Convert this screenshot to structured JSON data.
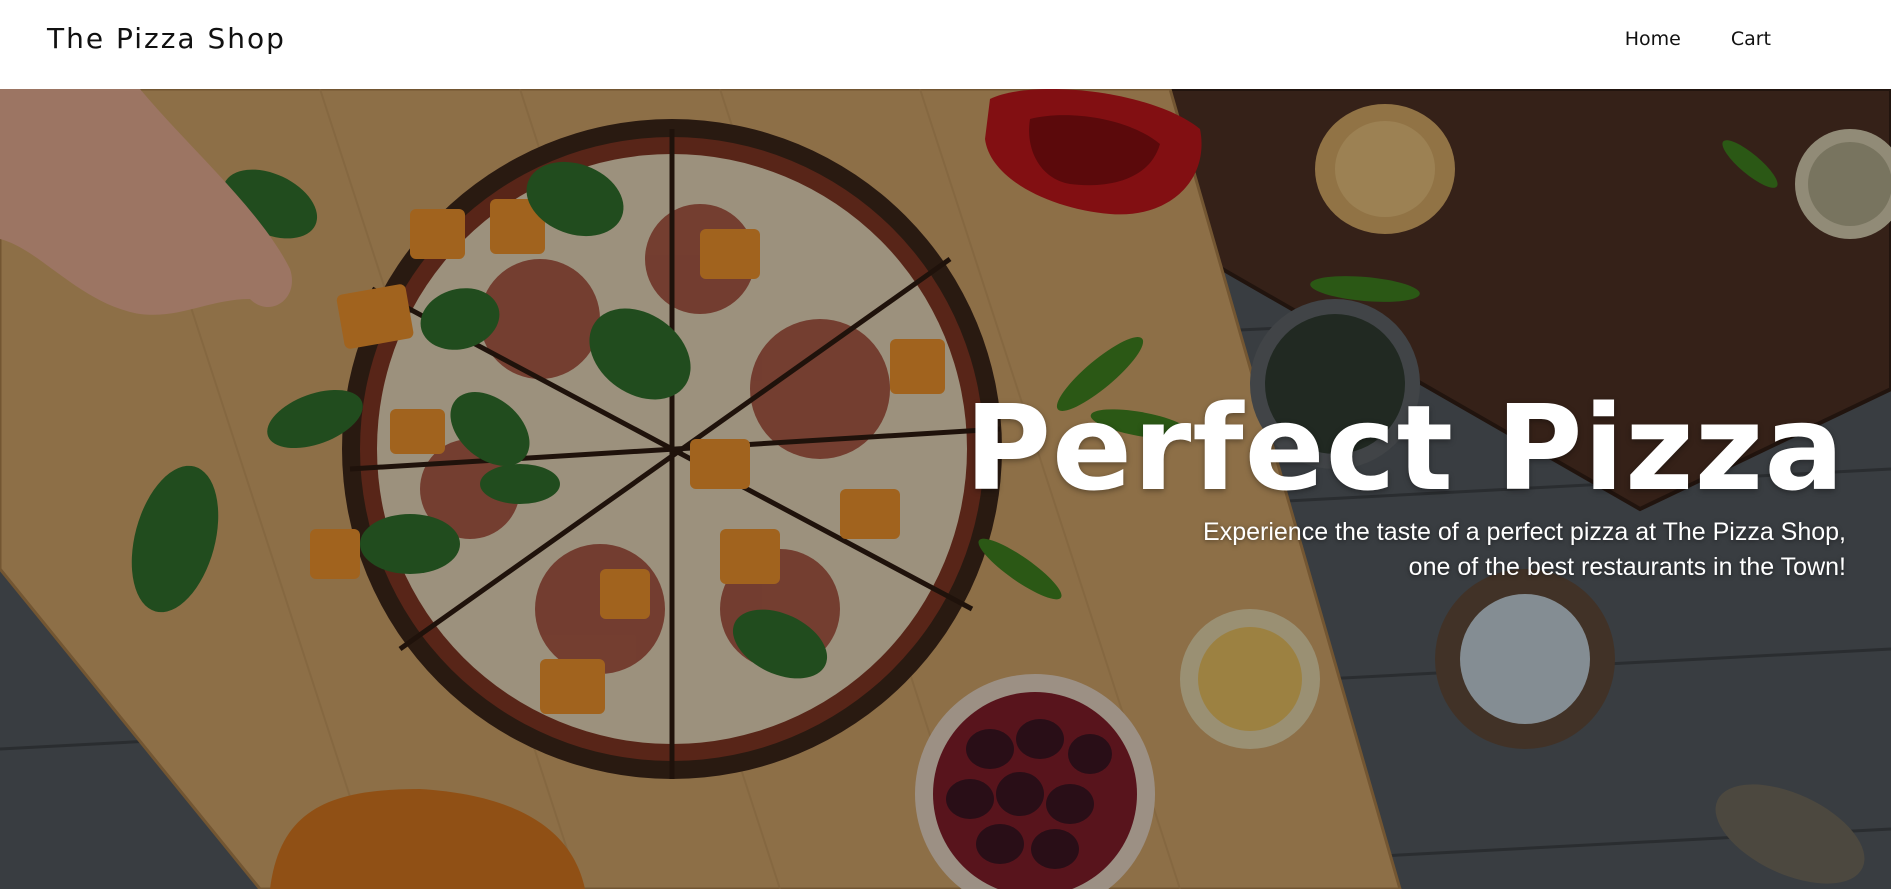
{
  "navbar": {
    "brand": "The Pizza Shop",
    "links": [
      {
        "label": "Home"
      },
      {
        "label": "Cart"
      }
    ]
  },
  "hero": {
    "title": "Perfect Pizza",
    "subtitle_line1": "Experience the taste of a perfect pizza at The Pizza Shop,",
    "subtitle_line2": "one of the best restaurants in the Town!"
  },
  "colors": {
    "nav_background": "#ffffff",
    "nav_text": "#111111",
    "hero_text": "#ffffff",
    "wood_table": "#4a4e52",
    "cutting_board": "#c79a5e"
  },
  "icons": [
    "pizza-photo"
  ]
}
